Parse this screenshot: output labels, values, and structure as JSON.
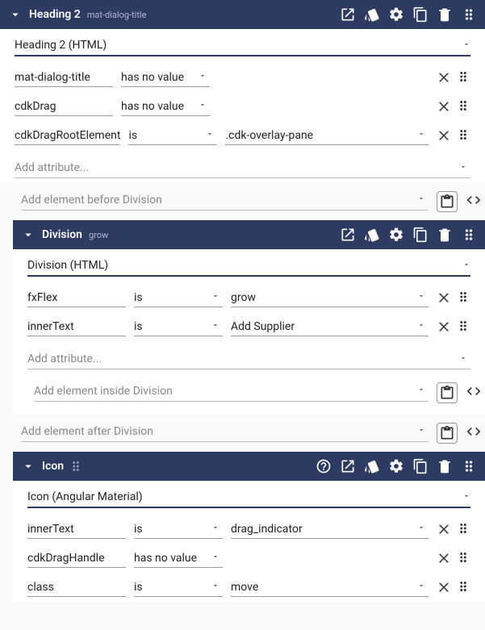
{
  "nodes": [
    {
      "title": "Heading 2",
      "badge": "mat-dialog-title",
      "show_drag_mini": false,
      "show_help": false,
      "type_label": "Heading 2 (HTML)",
      "attrs": [
        {
          "name": "mat-dialog-title",
          "op": "has no value",
          "value": null,
          "show_value": false
        },
        {
          "name": "cdkDrag",
          "op": "has no value",
          "value": null,
          "show_value": false
        },
        {
          "name": "cdkDragRootElement",
          "op": "is",
          "value": ".cdk-overlay-pane",
          "show_value": true
        }
      ],
      "add_attr_placeholder": "Add attribute...",
      "inside": null
    }
  ],
  "insert_before": "Add element before Division",
  "nodes2": [
    {
      "title": "Division",
      "badge": "grow",
      "show_drag_mini": false,
      "show_help": false,
      "type_label": "Division (HTML)",
      "attrs": [
        {
          "name": "fxFlex",
          "op": "is",
          "value": "grow",
          "show_value": true
        },
        {
          "name": "innerText",
          "op": "is",
          "value": "Add Supplier",
          "show_value": true
        }
      ],
      "add_attr_placeholder": "Add attribute...",
      "inside": "Add element inside Division"
    }
  ],
  "insert_after": "Add element after Division",
  "nodes3": [
    {
      "title": "Icon",
      "badge": "",
      "show_drag_mini": true,
      "show_help": true,
      "type_label": "Icon (Angular Material)",
      "attrs": [
        {
          "name": "innerText",
          "op": "is",
          "value": "drag_indicator",
          "show_value": true
        },
        {
          "name": "cdkDragHandle",
          "op": "has no value",
          "value": null,
          "show_value": false
        },
        {
          "name": "class",
          "op": "is",
          "value": "move",
          "show_value": true
        }
      ],
      "add_attr_placeholder": null,
      "inside": null
    }
  ]
}
